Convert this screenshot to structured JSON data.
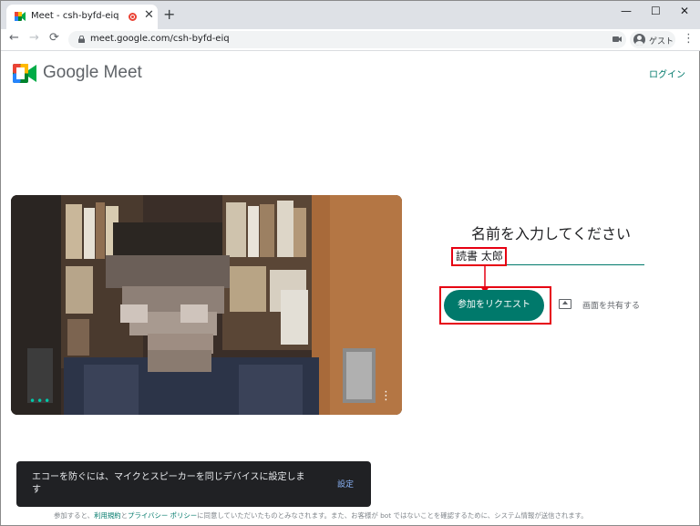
{
  "browser": {
    "tab": {
      "title": "Meet - csh-byfd-eiq",
      "recording_icon": "recording-dot-icon",
      "close_glyph": "✕"
    },
    "new_tab_glyph": "+",
    "window_controls": {
      "minimize": "—",
      "maximize": "☐",
      "close": "✕"
    },
    "nav": {
      "back": "←",
      "forward": "→",
      "reload": "⟳"
    },
    "url": "meet.google.com/csh-byfd-eiq",
    "profile_label": "ゲスト",
    "menu_glyph": "⋮"
  },
  "meet": {
    "brand": "Google Meet",
    "login_link": "ログイン",
    "prompt": "名前を入力してください",
    "name_value": "読書 太郎",
    "join_button": "参加をリクエスト",
    "share_screen": "画面を共有する",
    "video_dots": "•••",
    "video_more": "⋮"
  },
  "snackbar": {
    "message": "エコーを防ぐには、マイクとスピーカーを同じデバイスに設定します",
    "action": "設定"
  },
  "footer": {
    "prefix": "参加すると、",
    "terms": "利用規約",
    "and": "と",
    "privacy": "プライバシー ポリシー",
    "suffix": "に同意していただいたものとみなされます。また、お客様が bot ではないことを確認するために、システム情報が送信されます。"
  },
  "colors": {
    "accent": "#00796b",
    "highlight": "#e60012",
    "snackbar_bg": "#202124"
  }
}
